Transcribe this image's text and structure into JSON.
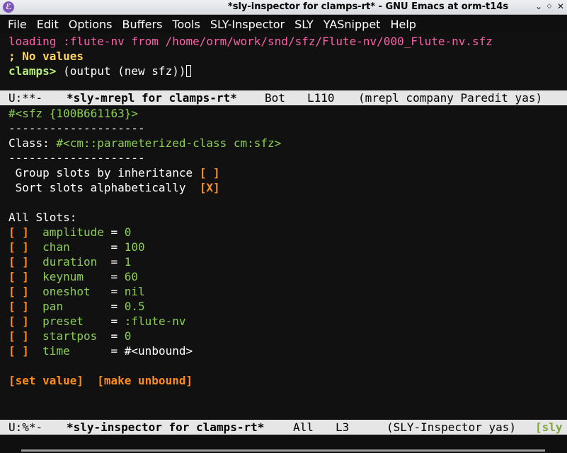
{
  "window": {
    "title": "*sly-inspector for clamps-rt* - GNU Emacs at orm-t14s",
    "app_icon": "emacs-icon",
    "buttons": {
      "minimize": "⌄",
      "maximize": "◇",
      "close": "✕"
    }
  },
  "menubar": [
    "File",
    "Edit",
    "Options",
    "Buffers",
    "Tools",
    "SLY-Inspector",
    "SLY",
    "YASnippet",
    "Help"
  ],
  "repl": {
    "loading_line": "loading :flute-nv from /home/orm/work/snd/sfz/Flute-nv/000_Flute-nv.sfz",
    "no_values": "; No values",
    "prompt": "clamps>",
    "input": " (output (new sfz))"
  },
  "modeline1": {
    "status": "U:**-",
    "buffer": "*sly-mrepl for clamps-rt*",
    "position": "Bot",
    "line": "L110",
    "modes": "(mrepl company Paredit yas)"
  },
  "inspector": {
    "object": "#<sfz {100B661163}>",
    "separator": "--------------------",
    "class_label": "Class:",
    "class_value": " #<cm::parameterized-class cm:sfz>",
    "group_slots_label": " Group slots by inheritance ",
    "group_slots_box": "[ ]",
    "sort_slots_label": " Sort slots alphabetically  ",
    "sort_slots_box": "[X]",
    "all_slots_label": "All Slots:",
    "slots": [
      {
        "box": "[ ]",
        "name": "amplitude",
        "value": "0"
      },
      {
        "box": "[ ]",
        "name": "chan     ",
        "value": "100"
      },
      {
        "box": "[ ]",
        "name": "duration ",
        "value": "1"
      },
      {
        "box": "[ ]",
        "name": "keynum   ",
        "value": "60"
      },
      {
        "box": "[ ]",
        "name": "oneshot  ",
        "value": "nil"
      },
      {
        "box": "[ ]",
        "name": "pan      ",
        "value": "0.5"
      },
      {
        "box": "[ ]",
        "name": "preset   ",
        "value": ":flute-nv"
      },
      {
        "box": "[ ]",
        "name": "startpos ",
        "value": "0"
      },
      {
        "box": "[ ]",
        "name": "time     ",
        "value": "#<unbound>"
      }
    ],
    "set_value": "[set value]",
    "make_unbound": "[make unbound]"
  },
  "modeline2": {
    "status": "U:%*-",
    "buffer": "*sly-inspector for clamps-rt*",
    "position": "All",
    "line": "L3",
    "modes": "(SLY-Inspector yas)",
    "extra": "[sly"
  },
  "colors": {
    "background": "#111111",
    "pink": "#ff5fa8",
    "green": "#8ccf54",
    "orange": "#ff8c1a",
    "modeline": "#e6e6e6"
  }
}
